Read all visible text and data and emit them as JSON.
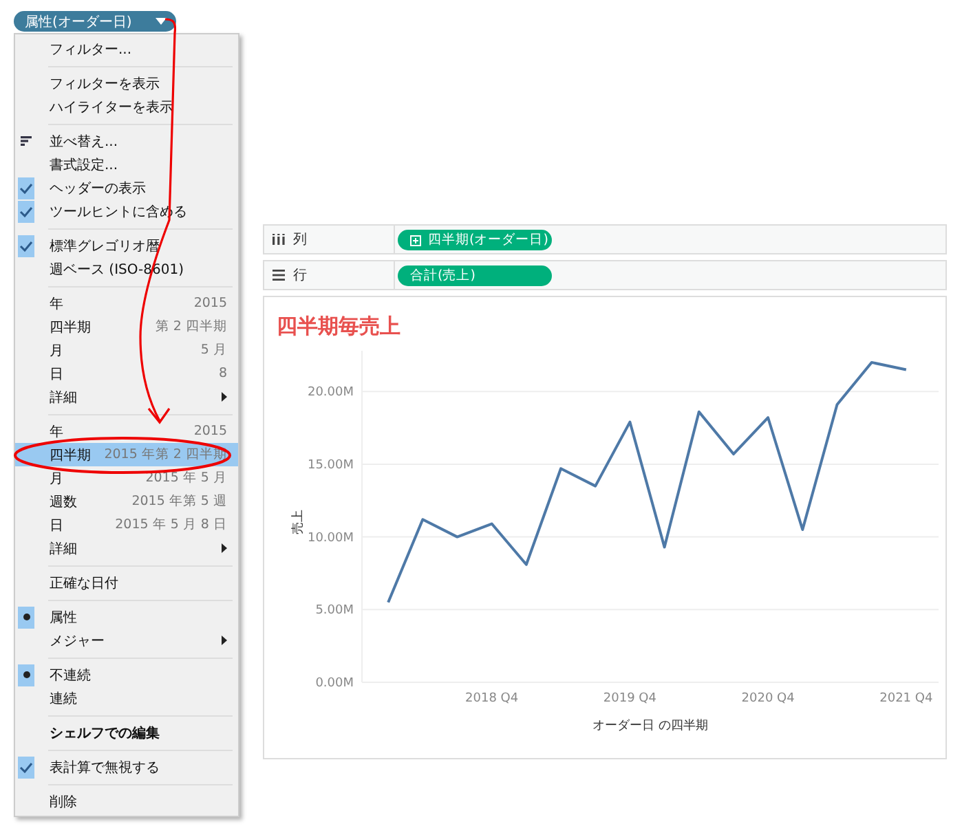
{
  "field_pill": {
    "label": "属性(オーダー日)"
  },
  "context_menu": {
    "groups": [
      {
        "items": [
          {
            "label": "フィルター...",
            "kind": "plain",
            "selected": false
          }
        ]
      },
      {
        "items": [
          {
            "label": "フィルターを表示",
            "kind": "plain",
            "selected": false
          },
          {
            "label": "ハイライターを表示",
            "kind": "plain",
            "selected": false
          }
        ]
      },
      {
        "items": [
          {
            "label": "並べ替え...",
            "kind": "sort",
            "selected": false
          },
          {
            "label": "書式設定...",
            "kind": "plain",
            "selected": false
          },
          {
            "label": "ヘッダーの表示",
            "kind": "check",
            "checked": true,
            "selected": false
          },
          {
            "label": "ツールヒントに含める",
            "kind": "check",
            "checked": true,
            "selected": false
          }
        ]
      },
      {
        "items": [
          {
            "label": "標準グレゴリオ暦",
            "kind": "check",
            "checked": true,
            "selected": false
          },
          {
            "label": "週ベース (ISO-8601)",
            "kind": "check",
            "checked": false,
            "selected": false
          }
        ]
      },
      {
        "items": [
          {
            "label": "年",
            "value": "2015",
            "kind": "plain",
            "selected": false
          },
          {
            "label": "四半期",
            "value": "第 2 四半期",
            "kind": "plain",
            "selected": false
          },
          {
            "label": "月",
            "value": "5 月",
            "kind": "plain",
            "selected": false
          },
          {
            "label": "日",
            "value": "8",
            "kind": "plain",
            "selected": false
          },
          {
            "label": "詳細",
            "kind": "submenu",
            "selected": false
          }
        ]
      },
      {
        "items": [
          {
            "label": "年",
            "value": "2015",
            "kind": "plain",
            "selected": false
          },
          {
            "label": "四半期",
            "value": "2015 年第 2 四半期",
            "kind": "plain",
            "selected": true
          },
          {
            "label": "月",
            "value": "2015 年 5 月",
            "kind": "plain",
            "selected": false
          },
          {
            "label": "週数",
            "value": "2015 年第 5 週",
            "kind": "plain",
            "selected": false
          },
          {
            "label": "日",
            "value": "2015 年 5 月 8 日",
            "kind": "plain",
            "selected": false
          },
          {
            "label": "詳細",
            "kind": "submenu",
            "selected": false
          }
        ]
      },
      {
        "items": [
          {
            "label": "正確な日付",
            "kind": "plain",
            "selected": false
          }
        ]
      },
      {
        "items": [
          {
            "label": "属性",
            "kind": "radio",
            "checked": true,
            "selected": false
          },
          {
            "label": "メジャー",
            "kind": "submenu",
            "selected": false
          }
        ]
      },
      {
        "items": [
          {
            "label": "不連続",
            "kind": "radio",
            "checked": true,
            "selected": false
          },
          {
            "label": "連続",
            "kind": "radio",
            "checked": false,
            "selected": false
          }
        ]
      },
      {
        "items": [
          {
            "label": "シェルフでの編集",
            "kind": "plain",
            "bold": true,
            "selected": false
          }
        ]
      },
      {
        "items": [
          {
            "label": "表計算で無視する",
            "kind": "check",
            "checked": true,
            "selected": false
          }
        ]
      },
      {
        "items": [
          {
            "label": "削除",
            "kind": "plain",
            "selected": false
          }
        ]
      }
    ]
  },
  "shelves": [
    {
      "kind": "columns",
      "label": "列",
      "pill": "四半期(オーダー日)"
    },
    {
      "kind": "rows",
      "label": "行",
      "pill": "合計(売上)"
    }
  ],
  "chart": {
    "title": "四半期毎売上",
    "chart_data": {
      "type": "line",
      "xlabel": "オーダー日 の四半期",
      "ylabel": "売上",
      "categories": [
        null,
        null,
        null,
        "2018 Q4",
        null,
        null,
        null,
        "2019 Q4",
        null,
        null,
        null,
        "2020 Q4",
        null,
        null,
        null,
        "2021 Q4"
      ],
      "grid": true,
      "series": [
        {
          "color": "#4e79a7",
          "values": [
            5.5,
            11.2,
            10.0,
            10.9,
            8.1,
            14.7,
            13.5,
            17.9,
            9.3,
            18.6,
            15.7,
            18.2,
            10.5,
            19.1,
            22.0,
            21.5
          ]
        }
      ],
      "ylim": [
        0,
        22.8
      ],
      "yticks": [
        {
          "value": 0,
          "label": "0.00M"
        },
        {
          "value": 5,
          "label": "5.00M"
        },
        {
          "value": 10,
          "label": "10.00M"
        },
        {
          "value": 15,
          "label": "15.00M"
        },
        {
          "value": 20,
          "label": "20.00M"
        }
      ]
    }
  }
}
